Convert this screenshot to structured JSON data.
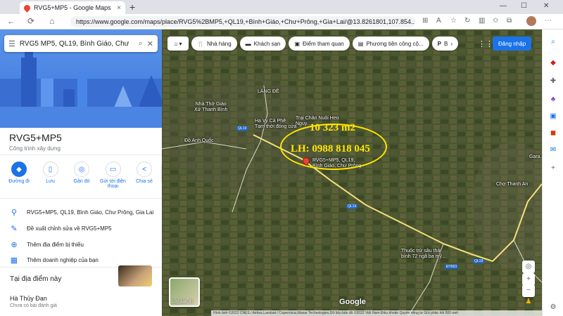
{
  "browser": {
    "tab_title": "RVG5+MP5 - Google Maps",
    "tab_close": "×",
    "new_tab": "+",
    "url": "https://www.google.com/maps/place/RVG5%2BMP5,+QL19,+Bình+Giáo,+Chư+Prông,+Gia+Lai/@13.8261801,107.854...",
    "back": "←",
    "refresh": "⟳",
    "home": "⌂",
    "min": "—",
    "max": "☐",
    "close": "✕",
    "menu": "⋯"
  },
  "search": {
    "menu_icon": "☰",
    "query": "RVG5 MP5, QL19, Bình Giáo, Chư",
    "search_icon": "⌕",
    "clear_icon": "✕"
  },
  "place": {
    "name": "RVG5+MP5",
    "category": "Công trình xây dựng"
  },
  "actions": [
    {
      "label": "Đường đi",
      "icon": "◆"
    },
    {
      "label": "Lưu",
      "icon": "▯"
    },
    {
      "label": "Gần đó",
      "icon": "◎"
    },
    {
      "label": "Gửi tới điện thoại",
      "icon": "▭"
    },
    {
      "label": "Chia sẻ",
      "icon": "<"
    }
  ],
  "info": {
    "address": "RVG5+MP5, QL19, Bình Giáo, Chư Prông, Gia Lai",
    "suggest_edit": "Đề xuất chỉnh sửa về RVG5+MP5",
    "add_missing": "Thêm địa điểm bị thiếu",
    "add_business": "Thêm doanh nghiệp của bạn"
  },
  "nearby": {
    "heading": "Tại địa điểm này",
    "entity_name": "Hà Thủy Đan",
    "entity_sub": "Chưa có bài đánh giá"
  },
  "chips": [
    {
      "label": "Nhà hàng",
      "icon": "🍴"
    },
    {
      "label": "Khách sạn",
      "icon": "▬"
    },
    {
      "label": "Điểm tham quan",
      "icon": "▣"
    },
    {
      "label": "Phương tiện công cộ...",
      "icon": "▤"
    },
    {
      "label": "B",
      "icon": "P"
    }
  ],
  "signin": "Đăng nhập",
  "map_labels": {
    "lang_de": "LÀNG ĐÊ",
    "church": "Nhà Thờ Giáo\nXứ Thanh Bình",
    "cafe": "Hạ Vy Cà Phê\nTạm thời đóng cửa",
    "anh_quoc": "Đồ Anh Quốc",
    "tru_trai": "Trại Chăn Nuôi Heo\nNguy…",
    "place_pin": "RVG5+MP5, QL19,\nBình Giáo, Chư Prông",
    "cho_thanh_an": "Chợ Thanh An",
    "gara": "Gara…",
    "thuoc": "Thuốc trừ sâu thái\nbình 72 ngã ba mỹ…",
    "ql19_a": "QL19",
    "ql19_b": "QL19",
    "ql19_c": "QL19",
    "dt663": "ĐT663"
  },
  "overlay": {
    "area": "10 323 m2",
    "phone": "LH: 0988 818 045"
  },
  "layers_label": "Lớp bản đồ",
  "google_logo": "Google",
  "footer": "Hình ảnh ©2022 CNES / Airbus,Landsat / Copernicus,Maxar Technologies,Dữ liệu bản đồ ©2022   Việt Nam   Điều khoản   Quyền riêng tư   Gửi phản hồi   500 mét",
  "colors": {
    "accent": "#1a73e8",
    "overlay": "#ffe600",
    "pin": "#ea4335"
  }
}
